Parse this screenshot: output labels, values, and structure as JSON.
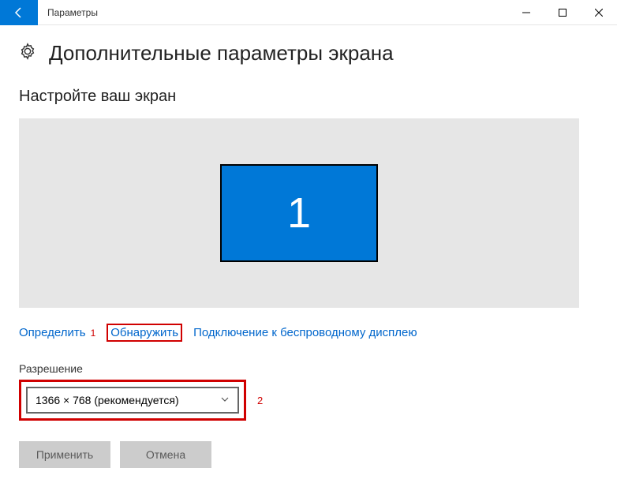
{
  "titlebar": {
    "title": "Параметры"
  },
  "header": {
    "title": "Дополнительные параметры экрана"
  },
  "section": {
    "title": "Настройте ваш экран"
  },
  "monitor": {
    "number": "1"
  },
  "links": {
    "identify": "Определить",
    "annot1": "1",
    "detect": "Обнаружить",
    "wireless": "Подключение к беспроводному дисплею"
  },
  "resolution": {
    "label": "Разрешение",
    "value": "1366 × 768 (рекомендуется)",
    "annot2": "2"
  },
  "buttons": {
    "apply": "Применить",
    "cancel": "Отмена"
  }
}
